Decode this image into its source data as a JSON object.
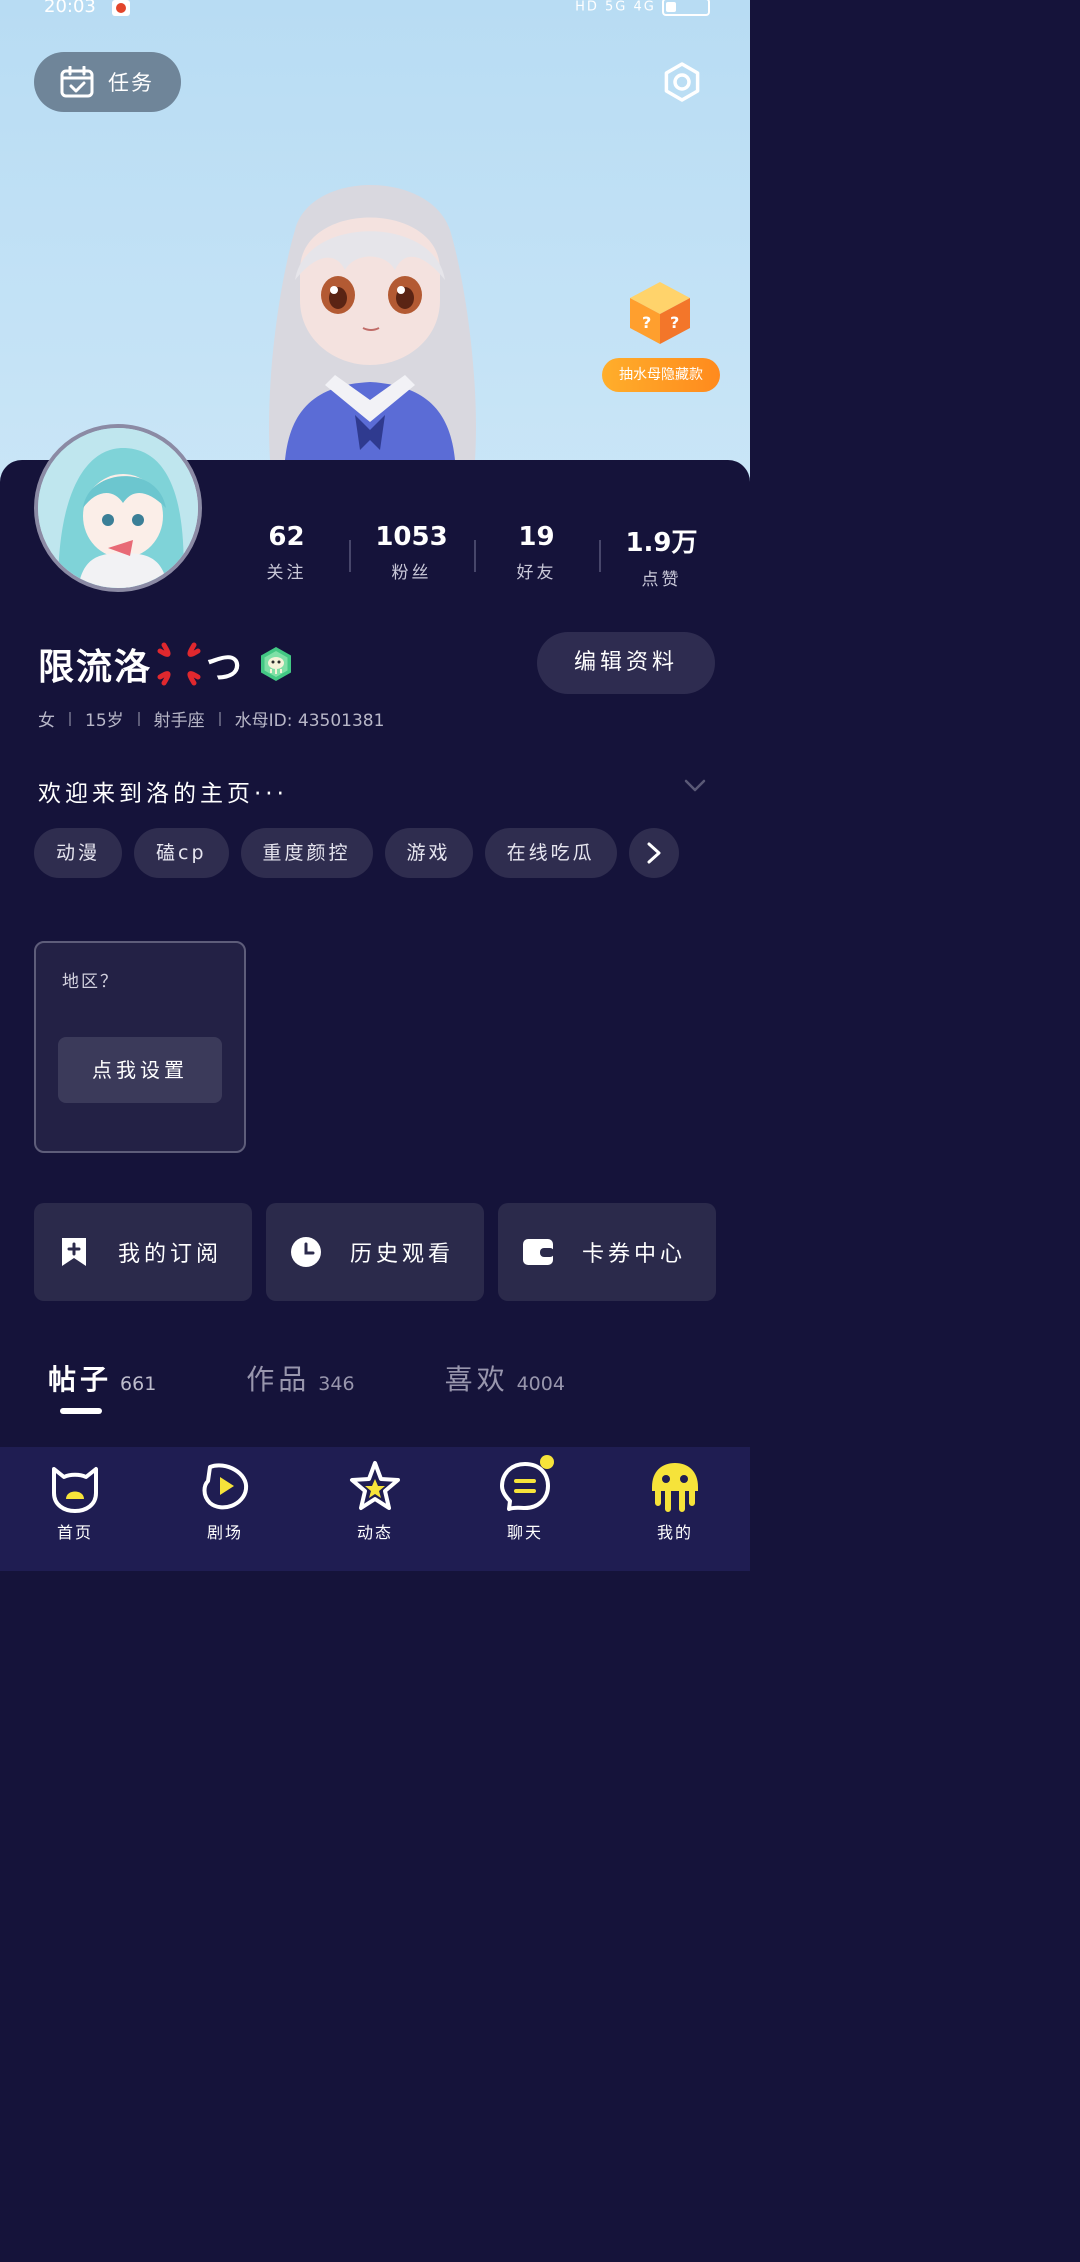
{
  "status_bar": {
    "time": "20:03",
    "signal_text": "HD 5G 4G"
  },
  "header": {
    "task_label": "任务"
  },
  "promo": {
    "label": "抽水母隐藏款"
  },
  "profile": {
    "stats": [
      {
        "num": "62",
        "label": "关注"
      },
      {
        "num": "1053",
        "label": "粉丝"
      },
      {
        "num": "19",
        "label": "好友"
      },
      {
        "num": "1.9万",
        "label": "点赞"
      }
    ],
    "name_part1": "限流洛",
    "name_part2": "つ",
    "edit_label": "编辑资料",
    "meta": {
      "gender": "女",
      "age": "15岁",
      "sign": "射手座",
      "id": "水母ID: 43501381"
    },
    "bio": "欢迎来到洛的主页···",
    "tags": [
      "动漫",
      "磕cp",
      "重度颜控",
      "游戏",
      "在线吃瓜"
    ]
  },
  "region": {
    "question": "地区？",
    "button": "点我设置"
  },
  "quick_actions": [
    {
      "label": "我的订阅",
      "icon": "bookmark-plus-icon"
    },
    {
      "label": "历史观看",
      "icon": "clock-icon"
    },
    {
      "label": "卡券中心",
      "icon": "wallet-icon"
    }
  ],
  "tabs": [
    {
      "label": "帖子",
      "count": "661"
    },
    {
      "label": "作品",
      "count": "346"
    },
    {
      "label": "喜欢",
      "count": "4004"
    }
  ],
  "nav": [
    {
      "label": "首页",
      "icon": "home-cat-icon"
    },
    {
      "label": "剧场",
      "icon": "theater-play-icon"
    },
    {
      "label": "动态",
      "icon": "star-icon"
    },
    {
      "label": "聊天",
      "icon": "chat-icon"
    },
    {
      "label": "我的",
      "icon": "jellyfish-icon"
    }
  ],
  "colors": {
    "background": "#15133a",
    "card": "#2b2a4b",
    "accent_yellow": "#f6e33a",
    "promo_orange": "#ff9a24"
  }
}
